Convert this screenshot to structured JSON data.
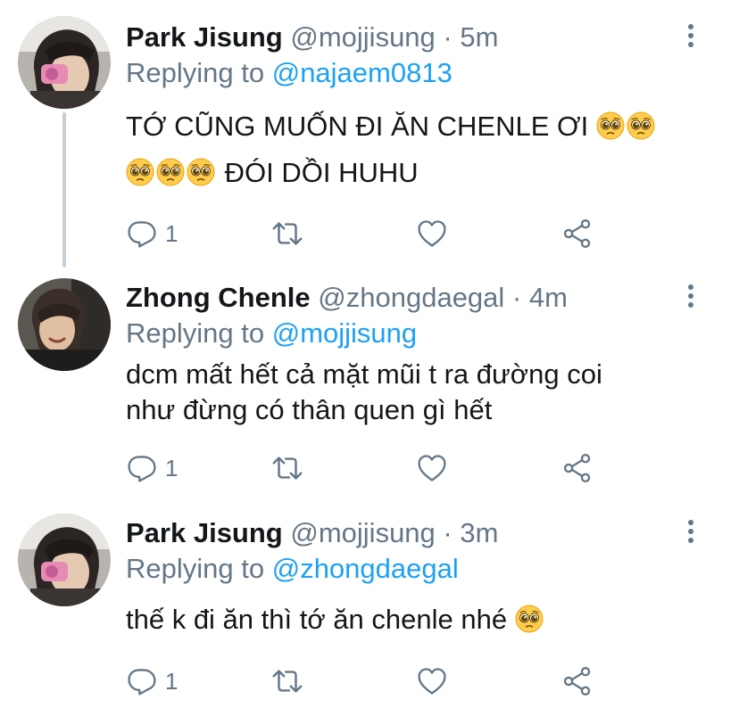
{
  "tweets": [
    {
      "name": "Park Jisung",
      "handle": "@mojjisung",
      "separator": "·",
      "time": "5m",
      "replying_prefix": "Replying to",
      "replying_to": "@najaem0813",
      "text_line1": "TỚ CŨNG MUỐN ĐI ĂN CHENLE ƠI",
      "text_line2": "ĐÓI DỒI HUHU",
      "reply_count": "1",
      "avatar_icon": "avatar-park-jisung"
    },
    {
      "name": "Zhong Chenle",
      "handle": "@zhongdaegal",
      "separator": "·",
      "time": "4m",
      "replying_prefix": "Replying to",
      "replying_to": "@mojjisung",
      "text_line1": "dcm mất hết cả mặt mũi t ra đường coi",
      "text_line2": "như đừng có thân quen gì hết",
      "reply_count": "1",
      "avatar_icon": "avatar-zhong-chenle"
    },
    {
      "name": "Park Jisung",
      "handle": "@mojjisung",
      "separator": "·",
      "time": "3m",
      "replying_prefix": "Replying to",
      "replying_to": "@zhongdaegal",
      "text_line1": "thế k đi ăn thì tớ ăn chenle nhé",
      "reply_count": "1",
      "avatar_icon": "avatar-park-jisung"
    }
  ],
  "colors": {
    "text": "#14171a",
    "secondary": "#657786",
    "link": "#1da1f2",
    "thread_line": "#c4cfd6"
  },
  "icons": {
    "reply": "reply-icon",
    "retweet": "retweet-icon",
    "like": "heart-icon",
    "share": "share-icon",
    "more": "more-vertical-icon",
    "emoji": "pleading-face-emoji"
  }
}
